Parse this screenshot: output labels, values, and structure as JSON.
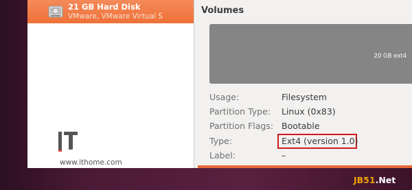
{
  "sidebar": {
    "selected_disk": {
      "title": "21 GB Hard Disk",
      "subtitle": "VMware, VMware Virtual S",
      "icon": "hard-disk-icon"
    },
    "watermark": {
      "logo_text": "IT",
      "url": "www.ithome.com"
    }
  },
  "main": {
    "section_title": "Volumes",
    "volume_bar_label": "20 GB ext4",
    "properties": [
      {
        "label": "Usage:",
        "value": "Filesystem"
      },
      {
        "label": "Partition Type:",
        "value": "Linux (0x83)"
      },
      {
        "label": "Partition Flags:",
        "value": "Bootable"
      },
      {
        "label": "Type:",
        "value": "Ext4 (version 1.0)"
      },
      {
        "label": "Label:",
        "value": "–"
      }
    ]
  },
  "corner_watermark": {
    "part1": "JB51",
    "part2": ".Net"
  },
  "colors": {
    "selection": "#f07746",
    "volume_bar": "#858585",
    "highlight_box": "#d01a1a",
    "desktop": "#4a1a35"
  }
}
